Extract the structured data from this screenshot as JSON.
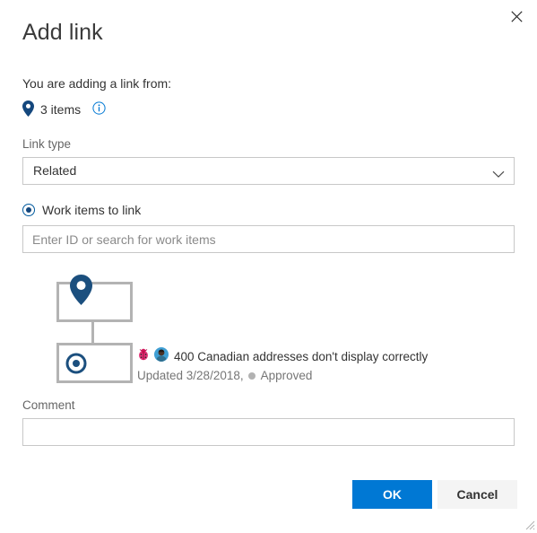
{
  "dialog": {
    "title": "Add link",
    "close_label": "Close",
    "close_icon": "close-icon",
    "resize_grip": "resize-grip"
  },
  "source": {
    "lead_text": "You are adding a link from:",
    "pin_icon": "location-pin-icon",
    "items_count_label": "3 items",
    "info_icon": "info-circle-icon"
  },
  "link_type": {
    "label": "Link type",
    "selected": "Related",
    "options": [
      "Related"
    ],
    "chevron_icon": "chevron-down-icon"
  },
  "work_items": {
    "radio_label": "Work items to link",
    "radio_icon": "radio-selected-icon",
    "radio_checked": true,
    "search_value": "",
    "search_placeholder": "Enter ID or search for work items"
  },
  "tree": {
    "parent_node_icon": "location-pin-icon",
    "child_node_icon": "target-bullseye-icon",
    "item": {
      "type_icon": "bug-icon",
      "avatar_icon": "user-avatar",
      "title": "400 Canadian addresses don't display correctly",
      "updated_text": "Updated 3/28/2018,",
      "state_dot_color": "#b2b2b2",
      "state": "Approved"
    }
  },
  "comment": {
    "label": "Comment",
    "value": "",
    "placeholder": ""
  },
  "footer": {
    "ok_label": "OK",
    "cancel_label": "Cancel"
  },
  "colors": {
    "accent": "#0078d4",
    "icon_navy": "#14477d",
    "border": "#c8c8c8",
    "tree_border": "#b3b3b3",
    "muted_text": "#767676",
    "bug_red": "#e5357a"
  }
}
